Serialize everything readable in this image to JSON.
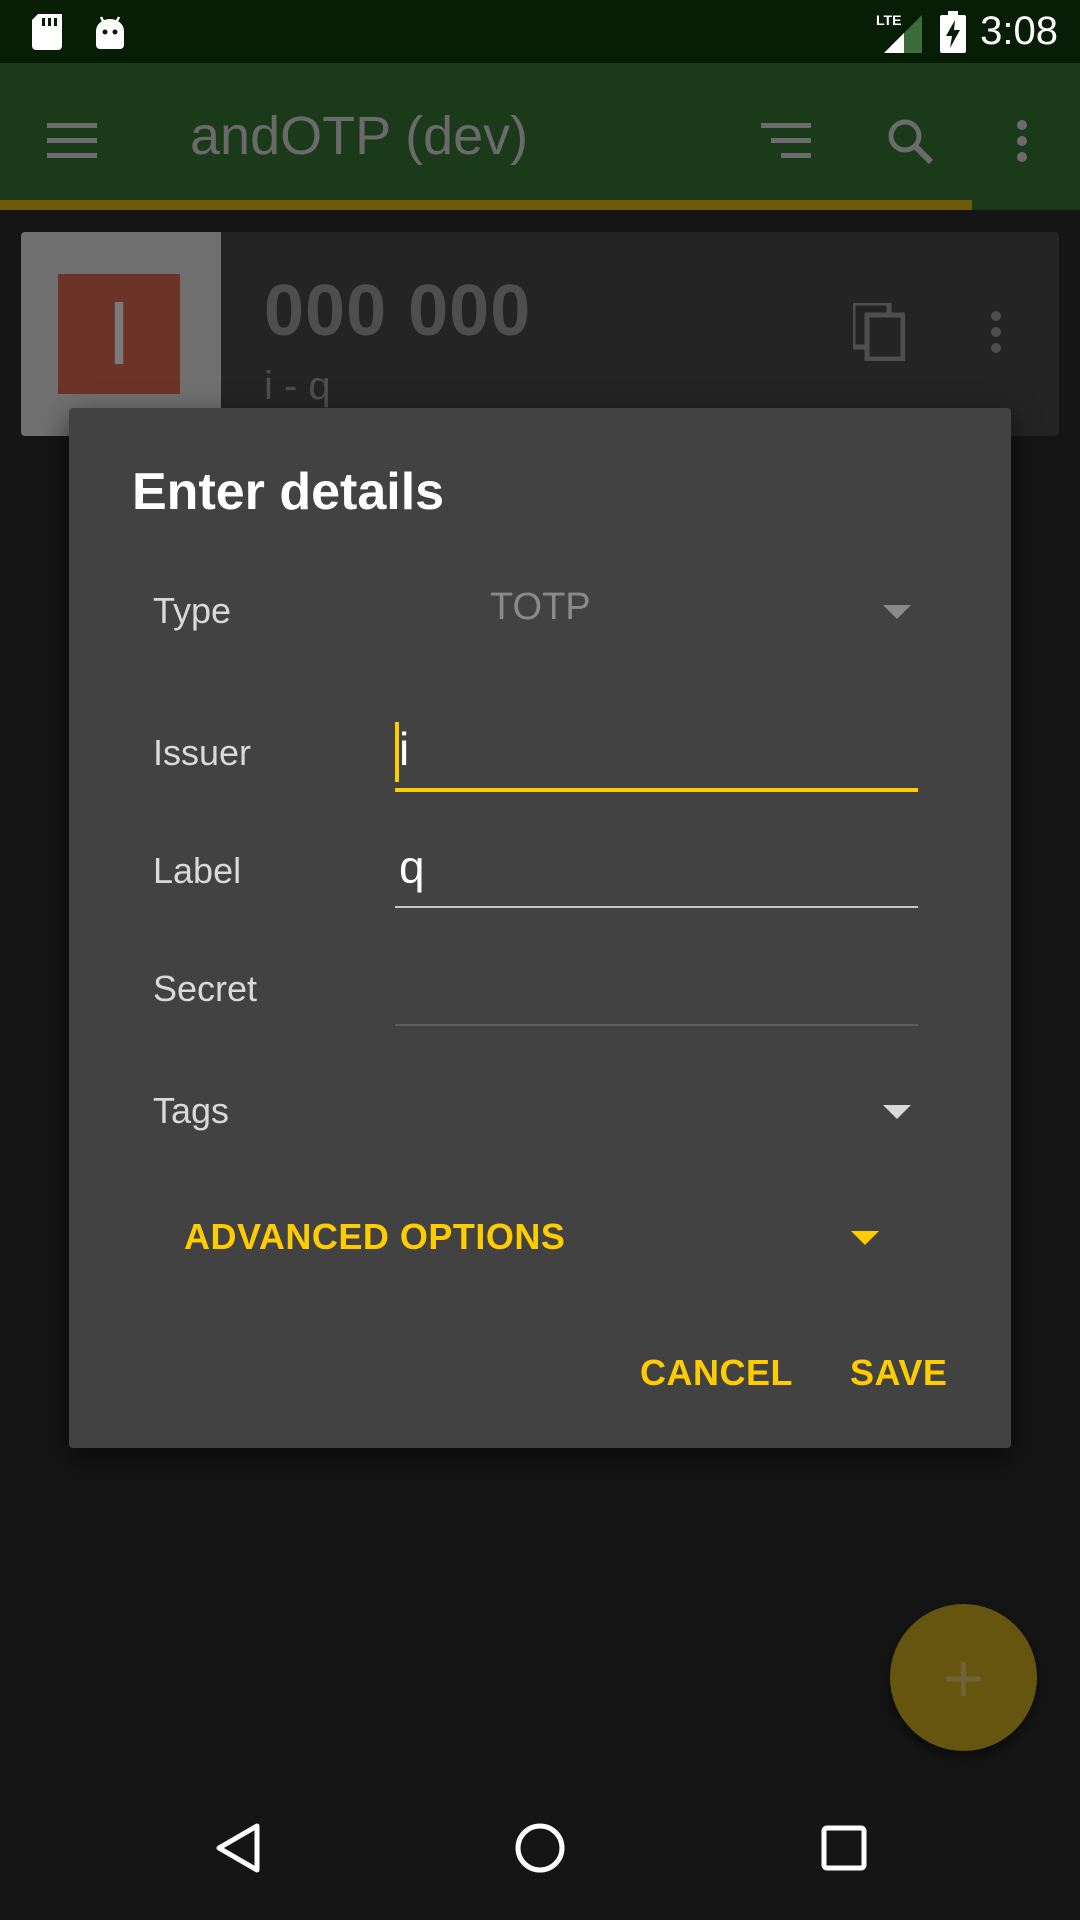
{
  "status_bar": {
    "time": "3:08",
    "network": "LTE",
    "icons": [
      "sd-card-icon",
      "android-icon",
      "signal-icon",
      "battery-charging-icon"
    ]
  },
  "app_bar": {
    "title": "andOTP (dev)",
    "icons": [
      "menu-icon",
      "sort-icon",
      "search-icon",
      "more-vert-icon"
    ],
    "progress_fraction": 0.9
  },
  "entry": {
    "thumbnail_letter": "I",
    "token": "000 000",
    "subtitle": "i - q",
    "icons": [
      "copy-icon",
      "more-vert-icon"
    ]
  },
  "dialog": {
    "title": "Enter details",
    "fields": {
      "type": {
        "label": "Type",
        "value": "TOTP"
      },
      "issuer": {
        "label": "Issuer",
        "value": "i"
      },
      "label": {
        "label": "Label",
        "value": "q"
      },
      "secret": {
        "label": "Secret",
        "value": ""
      },
      "tags": {
        "label": "Tags"
      }
    },
    "advanced_options": "ADVANCED OPTIONS",
    "buttons": {
      "cancel": "CANCEL",
      "save": "SAVE"
    }
  },
  "fab": {
    "label": "+"
  },
  "nav_bar": {
    "icons": [
      "back-icon",
      "home-icon",
      "recents-icon"
    ]
  },
  "colors": {
    "accent": "#ffcc00",
    "dialog": "#424242",
    "app_bar": "#1a3a19"
  }
}
